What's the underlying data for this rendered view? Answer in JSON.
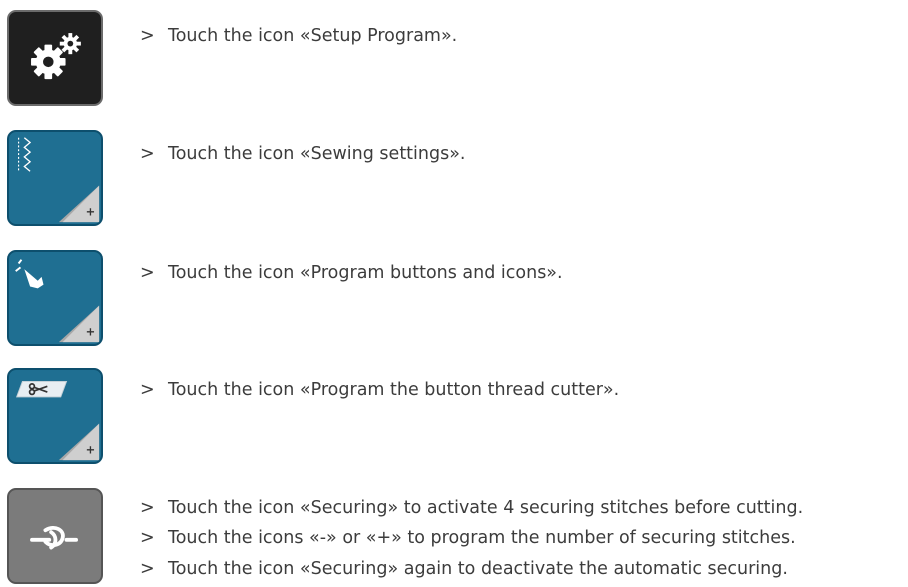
{
  "steps": [
    {
      "icon": "setup-program-icon",
      "lines": [
        "Touch the icon «Setup Program»."
      ]
    },
    {
      "icon": "sewing-settings-icon",
      "lines": [
        "Touch the icon «Sewing settings»."
      ]
    },
    {
      "icon": "program-buttons-icon",
      "lines": [
        "Touch the icon «Program buttons and icons»."
      ]
    },
    {
      "icon": "thread-cutter-icon",
      "lines": [
        "Touch the icon «Program the button thread cutter»."
      ]
    },
    {
      "icon": "securing-icon",
      "lines": [
        "Touch the icon «Securing» to activate 4 securing stitches before cutting.",
        "Touch the icons «-» or «+» to program the number of securing stitches.",
        "Touch the icon «Securing» again to deactivate the automatic securing."
      ]
    }
  ],
  "bullet": ">",
  "colors": {
    "dark": "#1f1f1f",
    "blue": "#1f6f92",
    "grey": "#7b7b7b"
  }
}
